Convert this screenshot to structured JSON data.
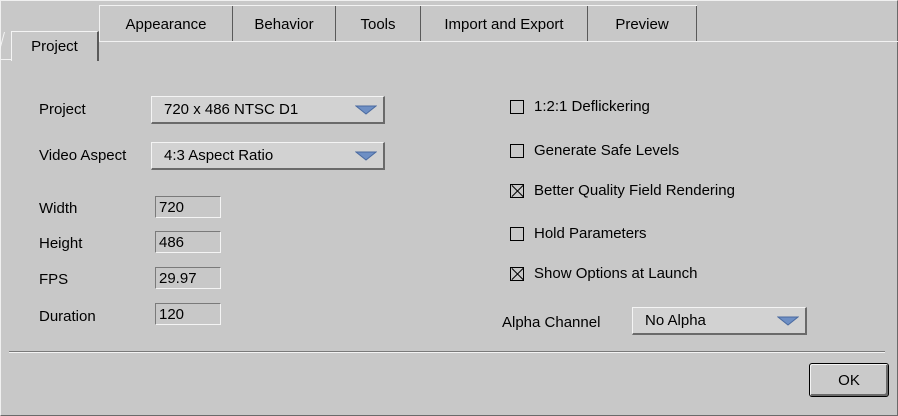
{
  "tabs": {
    "active": "Project",
    "items": [
      "Appearance",
      "Behavior",
      "Tools",
      "Import and Export",
      "Preview"
    ]
  },
  "project": {
    "project_label": "Project",
    "project_value": "720 x 486 NTSC D1",
    "aspect_label": "Video Aspect",
    "aspect_value": "4:3 Aspect Ratio",
    "width_label": "Width",
    "width_value": "720",
    "height_label": "Height",
    "height_value": "486",
    "fps_label": "FPS",
    "fps_value": "29.97",
    "duration_label": "Duration",
    "duration_value": "120"
  },
  "options": [
    {
      "label": "1:2:1 Deflickering",
      "checked": false
    },
    {
      "label": "Generate Safe Levels",
      "checked": false
    },
    {
      "label": "Better Quality Field Rendering",
      "checked": true
    },
    {
      "label": "Hold Parameters",
      "checked": false
    },
    {
      "label": "Show Options at Launch",
      "checked": true
    }
  ],
  "alpha": {
    "label": "Alpha Channel",
    "value": "No Alpha"
  },
  "ok_label": "OK",
  "colors": {
    "panel": "#c8c8c8",
    "arrow": "#6e8fc4"
  }
}
